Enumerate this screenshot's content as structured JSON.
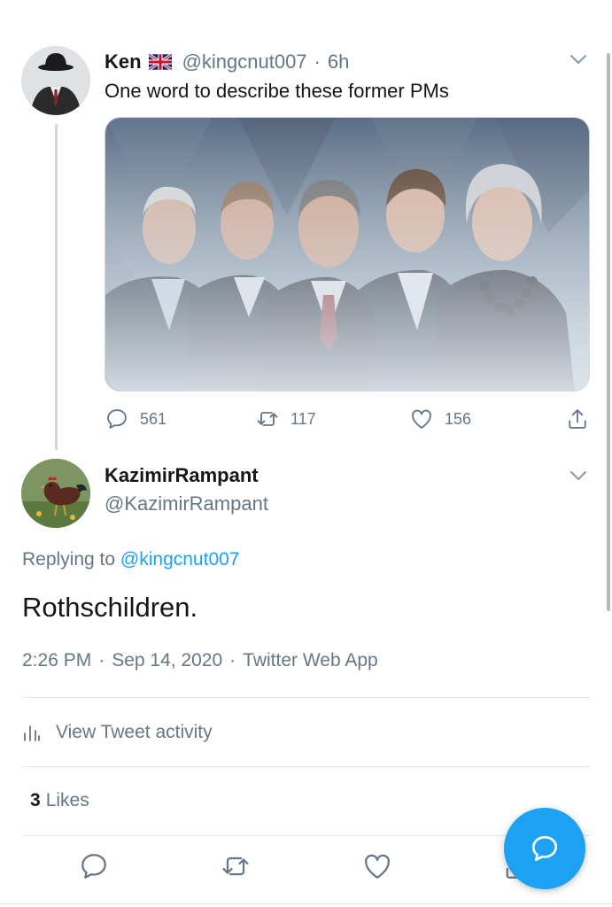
{
  "parent_tweet": {
    "author_name": "Ken",
    "flag_icon": "uk-flag-icon",
    "handle": "@kingcnut007",
    "separator": "·",
    "time": "6h",
    "text": "One word to describe these former PMs",
    "image_icon": "photo-former-prime-ministers",
    "replies": "561",
    "retweets": "117",
    "likes": "156"
  },
  "reply_tweet": {
    "author_name": "KazimirRampant",
    "handle": "@KazimirRampant",
    "replying_prefix": "Replying to",
    "replying_mention": "@kingcnut007",
    "text": "Rothschildren.",
    "time": "2:26 PM",
    "date": "Sep 14, 2020",
    "source": "Twitter Web App",
    "activity_label": "View Tweet activity",
    "likes_count": "3",
    "likes_label": "Likes"
  },
  "icons": {
    "reply": "reply-icon",
    "retweet": "retweet-icon",
    "like": "heart-icon",
    "share": "share-icon",
    "caret": "chevron-down-icon",
    "activity": "bar-chart-icon",
    "compose": "compose-reply-icon"
  },
  "colors": {
    "accent": "#1da1f2",
    "secondary_text": "#657786",
    "primary_text": "#14171a",
    "divider": "#e1e8ed"
  }
}
